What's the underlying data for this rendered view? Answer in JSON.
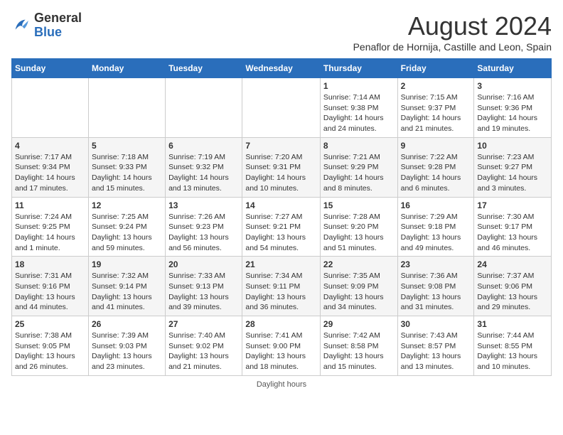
{
  "header": {
    "logo_general": "General",
    "logo_blue": "Blue",
    "month_title": "August 2024",
    "subtitle": "Penaflor de Hornija, Castille and Leon, Spain"
  },
  "days_of_week": [
    "Sunday",
    "Monday",
    "Tuesday",
    "Wednesday",
    "Thursday",
    "Friday",
    "Saturday"
  ],
  "weeks": [
    [
      {
        "day": "",
        "info": ""
      },
      {
        "day": "",
        "info": ""
      },
      {
        "day": "",
        "info": ""
      },
      {
        "day": "",
        "info": ""
      },
      {
        "day": "1",
        "info": "Sunrise: 7:14 AM\nSunset: 9:38 PM\nDaylight: 14 hours and 24 minutes."
      },
      {
        "day": "2",
        "info": "Sunrise: 7:15 AM\nSunset: 9:37 PM\nDaylight: 14 hours and 21 minutes."
      },
      {
        "day": "3",
        "info": "Sunrise: 7:16 AM\nSunset: 9:36 PM\nDaylight: 14 hours and 19 minutes."
      }
    ],
    [
      {
        "day": "4",
        "info": "Sunrise: 7:17 AM\nSunset: 9:34 PM\nDaylight: 14 hours and 17 minutes."
      },
      {
        "day": "5",
        "info": "Sunrise: 7:18 AM\nSunset: 9:33 PM\nDaylight: 14 hours and 15 minutes."
      },
      {
        "day": "6",
        "info": "Sunrise: 7:19 AM\nSunset: 9:32 PM\nDaylight: 14 hours and 13 minutes."
      },
      {
        "day": "7",
        "info": "Sunrise: 7:20 AM\nSunset: 9:31 PM\nDaylight: 14 hours and 10 minutes."
      },
      {
        "day": "8",
        "info": "Sunrise: 7:21 AM\nSunset: 9:29 PM\nDaylight: 14 hours and 8 minutes."
      },
      {
        "day": "9",
        "info": "Sunrise: 7:22 AM\nSunset: 9:28 PM\nDaylight: 14 hours and 6 minutes."
      },
      {
        "day": "10",
        "info": "Sunrise: 7:23 AM\nSunset: 9:27 PM\nDaylight: 14 hours and 3 minutes."
      }
    ],
    [
      {
        "day": "11",
        "info": "Sunrise: 7:24 AM\nSunset: 9:25 PM\nDaylight: 14 hours and 1 minute."
      },
      {
        "day": "12",
        "info": "Sunrise: 7:25 AM\nSunset: 9:24 PM\nDaylight: 13 hours and 59 minutes."
      },
      {
        "day": "13",
        "info": "Sunrise: 7:26 AM\nSunset: 9:23 PM\nDaylight: 13 hours and 56 minutes."
      },
      {
        "day": "14",
        "info": "Sunrise: 7:27 AM\nSunset: 9:21 PM\nDaylight: 13 hours and 54 minutes."
      },
      {
        "day": "15",
        "info": "Sunrise: 7:28 AM\nSunset: 9:20 PM\nDaylight: 13 hours and 51 minutes."
      },
      {
        "day": "16",
        "info": "Sunrise: 7:29 AM\nSunset: 9:18 PM\nDaylight: 13 hours and 49 minutes."
      },
      {
        "day": "17",
        "info": "Sunrise: 7:30 AM\nSunset: 9:17 PM\nDaylight: 13 hours and 46 minutes."
      }
    ],
    [
      {
        "day": "18",
        "info": "Sunrise: 7:31 AM\nSunset: 9:16 PM\nDaylight: 13 hours and 44 minutes."
      },
      {
        "day": "19",
        "info": "Sunrise: 7:32 AM\nSunset: 9:14 PM\nDaylight: 13 hours and 41 minutes."
      },
      {
        "day": "20",
        "info": "Sunrise: 7:33 AM\nSunset: 9:13 PM\nDaylight: 13 hours and 39 minutes."
      },
      {
        "day": "21",
        "info": "Sunrise: 7:34 AM\nSunset: 9:11 PM\nDaylight: 13 hours and 36 minutes."
      },
      {
        "day": "22",
        "info": "Sunrise: 7:35 AM\nSunset: 9:09 PM\nDaylight: 13 hours and 34 minutes."
      },
      {
        "day": "23",
        "info": "Sunrise: 7:36 AM\nSunset: 9:08 PM\nDaylight: 13 hours and 31 minutes."
      },
      {
        "day": "24",
        "info": "Sunrise: 7:37 AM\nSunset: 9:06 PM\nDaylight: 13 hours and 29 minutes."
      }
    ],
    [
      {
        "day": "25",
        "info": "Sunrise: 7:38 AM\nSunset: 9:05 PM\nDaylight: 13 hours and 26 minutes."
      },
      {
        "day": "26",
        "info": "Sunrise: 7:39 AM\nSunset: 9:03 PM\nDaylight: 13 hours and 23 minutes."
      },
      {
        "day": "27",
        "info": "Sunrise: 7:40 AM\nSunset: 9:02 PM\nDaylight: 13 hours and 21 minutes."
      },
      {
        "day": "28",
        "info": "Sunrise: 7:41 AM\nSunset: 9:00 PM\nDaylight: 13 hours and 18 minutes."
      },
      {
        "day": "29",
        "info": "Sunrise: 7:42 AM\nSunset: 8:58 PM\nDaylight: 13 hours and 15 minutes."
      },
      {
        "day": "30",
        "info": "Sunrise: 7:43 AM\nSunset: 8:57 PM\nDaylight: 13 hours and 13 minutes."
      },
      {
        "day": "31",
        "info": "Sunrise: 7:44 AM\nSunset: 8:55 PM\nDaylight: 13 hours and 10 minutes."
      }
    ]
  ],
  "footer": {
    "daylight_label": "Daylight hours"
  }
}
